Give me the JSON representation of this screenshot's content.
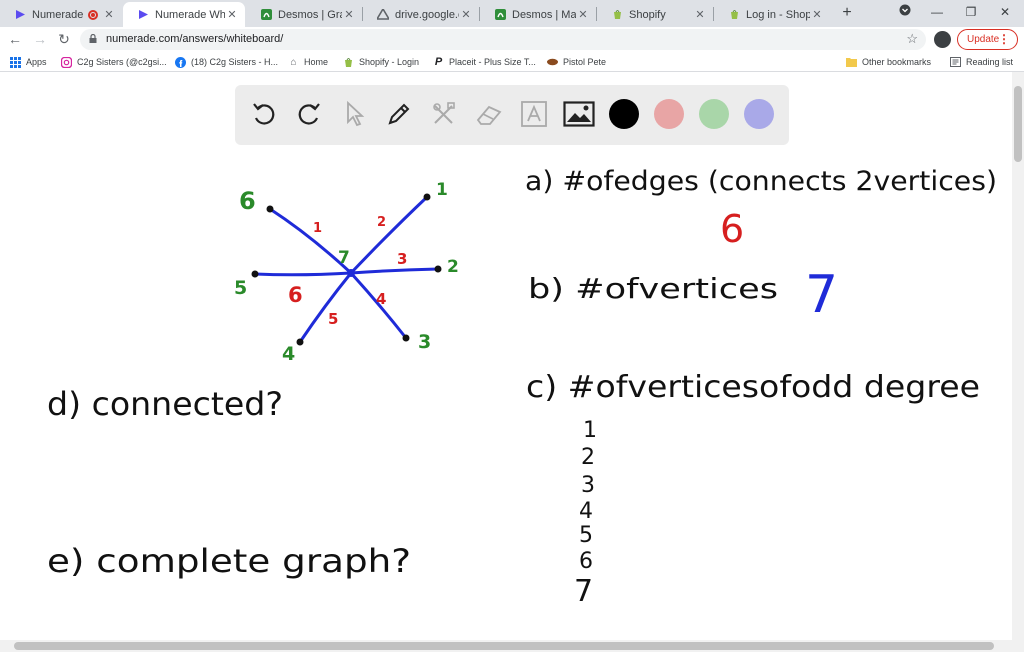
{
  "browser": {
    "tabs": [
      {
        "title": "Numerade",
        "favicon": "numerade-icon",
        "recording": true
      },
      {
        "title": "Numerade Whitel",
        "favicon": "numerade-icon",
        "active": true
      },
      {
        "title": "Desmos | Graphin",
        "favicon": "desmos-icon"
      },
      {
        "title": "drive.google.com",
        "favicon": "drive-icon"
      },
      {
        "title": "Desmos | Matrix C",
        "favicon": "desmos-icon"
      },
      {
        "title": "Shopify",
        "favicon": "shopify-icon"
      },
      {
        "title": "Log in - Shopify",
        "favicon": "shopify-icon"
      }
    ],
    "url": "numerade.com/answers/whiteboard/",
    "update_label": "Update",
    "bookmarks": [
      {
        "label": "Apps",
        "icon": "apps-grid-icon"
      },
      {
        "label": "C2g Sisters (@c2gsi...",
        "icon": "instagram-icon"
      },
      {
        "label": "(18) C2g Sisters - H...",
        "icon": "facebook-icon"
      },
      {
        "label": "Home",
        "icon": "home-icon"
      },
      {
        "label": "Shopify - Login",
        "icon": "shopify-icon"
      },
      {
        "label": "Placeit - Plus Size T...",
        "icon": "placeit-icon"
      },
      {
        "label": "Pistol Pete",
        "icon": "pistol-icon"
      }
    ],
    "other_bookmarks": "Other bookmarks",
    "reading_list": "Reading list"
  },
  "toolbar": {
    "tools": [
      "undo-icon",
      "redo-icon",
      "select-icon",
      "pen-icon",
      "tools-icon",
      "eraser-icon",
      "text-icon",
      "image-icon"
    ],
    "colors": [
      "#000000",
      "#e8a5a5",
      "#a9d6a9",
      "#a9a9e8"
    ]
  },
  "whiteboard": {
    "graph": {
      "vertex_labels": [
        "1",
        "2",
        "3",
        "4",
        "5",
        "6"
      ],
      "edge_labels": [
        "1",
        "2",
        "3",
        "4",
        "5",
        "6"
      ],
      "center_label": "7"
    },
    "q_a": "a) #ofedges (connects 2vertices)",
    "ans_a": "6",
    "q_b": "b) #ofvertices",
    "ans_b": "7",
    "q_c": "c) #ofverticesofodd degree",
    "list_c": [
      "1",
      "2",
      "3",
      "4",
      "5",
      "6",
      "7"
    ],
    "q_d": "d) connected?",
    "q_e": "e) complete graph?"
  },
  "colors": {
    "accent_red": "#d93025",
    "ink_blue": "#1f2bd8",
    "ink_green": "#2a8a2a",
    "ink_red": "#d61f1f"
  }
}
